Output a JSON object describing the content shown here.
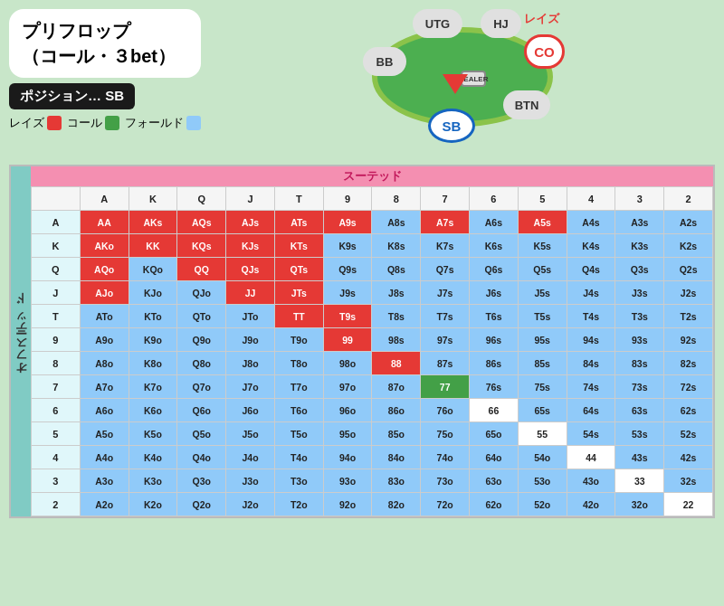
{
  "title_line1": "プリフロップ",
  "title_line2": "（コール・３bet）",
  "position_label": "ポジション… SB",
  "legend": {
    "raise": "レイズ",
    "call": "コール",
    "fold": "フォールド"
  },
  "table_label": "スーテッド",
  "offsuite_label": "オフスーテッド",
  "seats": {
    "utg": "UTG",
    "hj": "HJ",
    "co": "CO",
    "btn": "BTN",
    "sb": "SB",
    "bb": "BB",
    "dealer": "DEALER"
  },
  "raise_label": "レイズ",
  "col_headers": [
    "",
    "A",
    "K",
    "Q",
    "J",
    "T",
    "9",
    "8",
    "7",
    "6",
    "5",
    "4",
    "3",
    "2"
  ],
  "rows": [
    {
      "label": "A",
      "cells": [
        {
          "text": "AA",
          "color": "red"
        },
        {
          "text": "AKs",
          "color": "red"
        },
        {
          "text": "AQs",
          "color": "red"
        },
        {
          "text": "AJs",
          "color": "red"
        },
        {
          "text": "ATs",
          "color": "red"
        },
        {
          "text": "A9s",
          "color": "red"
        },
        {
          "text": "A8s",
          "color": "blue"
        },
        {
          "text": "A7s",
          "color": "red"
        },
        {
          "text": "A6s",
          "color": "blue"
        },
        {
          "text": "A5s",
          "color": "red"
        },
        {
          "text": "A4s",
          "color": "blue"
        },
        {
          "text": "A3s",
          "color": "blue"
        },
        {
          "text": "A2s",
          "color": "blue"
        }
      ]
    },
    {
      "label": "K",
      "cells": [
        {
          "text": "AKo",
          "color": "red"
        },
        {
          "text": "KK",
          "color": "red"
        },
        {
          "text": "KQs",
          "color": "red"
        },
        {
          "text": "KJs",
          "color": "red"
        },
        {
          "text": "KTs",
          "color": "red"
        },
        {
          "text": "K9s",
          "color": "blue"
        },
        {
          "text": "K8s",
          "color": "blue"
        },
        {
          "text": "K7s",
          "color": "blue"
        },
        {
          "text": "K6s",
          "color": "blue"
        },
        {
          "text": "K5s",
          "color": "blue"
        },
        {
          "text": "K4s",
          "color": "blue"
        },
        {
          "text": "K3s",
          "color": "blue"
        },
        {
          "text": "K2s",
          "color": "blue"
        }
      ]
    },
    {
      "label": "Q",
      "cells": [
        {
          "text": "AQo",
          "color": "red"
        },
        {
          "text": "KQo",
          "color": "blue"
        },
        {
          "text": "QQ",
          "color": "red"
        },
        {
          "text": "QJs",
          "color": "red"
        },
        {
          "text": "QTs",
          "color": "red"
        },
        {
          "text": "Q9s",
          "color": "blue"
        },
        {
          "text": "Q8s",
          "color": "blue"
        },
        {
          "text": "Q7s",
          "color": "blue"
        },
        {
          "text": "Q6s",
          "color": "blue"
        },
        {
          "text": "Q5s",
          "color": "blue"
        },
        {
          "text": "Q4s",
          "color": "blue"
        },
        {
          "text": "Q3s",
          "color": "blue"
        },
        {
          "text": "Q2s",
          "color": "blue"
        }
      ]
    },
    {
      "label": "J",
      "cells": [
        {
          "text": "AJo",
          "color": "red"
        },
        {
          "text": "KJo",
          "color": "blue"
        },
        {
          "text": "QJo",
          "color": "blue"
        },
        {
          "text": "JJ",
          "color": "red"
        },
        {
          "text": "JTs",
          "color": "red"
        },
        {
          "text": "J9s",
          "color": "blue"
        },
        {
          "text": "J8s",
          "color": "blue"
        },
        {
          "text": "J7s",
          "color": "blue"
        },
        {
          "text": "J6s",
          "color": "blue"
        },
        {
          "text": "J5s",
          "color": "blue"
        },
        {
          "text": "J4s",
          "color": "blue"
        },
        {
          "text": "J3s",
          "color": "blue"
        },
        {
          "text": "J2s",
          "color": "blue"
        }
      ]
    },
    {
      "label": "T",
      "cells": [
        {
          "text": "ATo",
          "color": "blue"
        },
        {
          "text": "KTo",
          "color": "blue"
        },
        {
          "text": "QTo",
          "color": "blue"
        },
        {
          "text": "JTo",
          "color": "blue"
        },
        {
          "text": "TT",
          "color": "red"
        },
        {
          "text": "T9s",
          "color": "red"
        },
        {
          "text": "T8s",
          "color": "blue"
        },
        {
          "text": "T7s",
          "color": "blue"
        },
        {
          "text": "T6s",
          "color": "blue"
        },
        {
          "text": "T5s",
          "color": "blue"
        },
        {
          "text": "T4s",
          "color": "blue"
        },
        {
          "text": "T3s",
          "color": "blue"
        },
        {
          "text": "T2s",
          "color": "blue"
        }
      ]
    },
    {
      "label": "9",
      "cells": [
        {
          "text": "A9o",
          "color": "blue"
        },
        {
          "text": "K9o",
          "color": "blue"
        },
        {
          "text": "Q9o",
          "color": "blue"
        },
        {
          "text": "J9o",
          "color": "blue"
        },
        {
          "text": "T9o",
          "color": "blue"
        },
        {
          "text": "99",
          "color": "red"
        },
        {
          "text": "98s",
          "color": "blue"
        },
        {
          "text": "97s",
          "color": "blue"
        },
        {
          "text": "96s",
          "color": "blue"
        },
        {
          "text": "95s",
          "color": "blue"
        },
        {
          "text": "94s",
          "color": "blue"
        },
        {
          "text": "93s",
          "color": "blue"
        },
        {
          "text": "92s",
          "color": "blue"
        }
      ]
    },
    {
      "label": "8",
      "cells": [
        {
          "text": "A8o",
          "color": "blue"
        },
        {
          "text": "K8o",
          "color": "blue"
        },
        {
          "text": "Q8o",
          "color": "blue"
        },
        {
          "text": "J8o",
          "color": "blue"
        },
        {
          "text": "T8o",
          "color": "blue"
        },
        {
          "text": "98o",
          "color": "blue"
        },
        {
          "text": "88",
          "color": "red"
        },
        {
          "text": "87s",
          "color": "blue"
        },
        {
          "text": "86s",
          "color": "blue"
        },
        {
          "text": "85s",
          "color": "blue"
        },
        {
          "text": "84s",
          "color": "blue"
        },
        {
          "text": "83s",
          "color": "blue"
        },
        {
          "text": "82s",
          "color": "blue"
        }
      ]
    },
    {
      "label": "7",
      "cells": [
        {
          "text": "A7o",
          "color": "blue"
        },
        {
          "text": "K7o",
          "color": "blue"
        },
        {
          "text": "Q7o",
          "color": "blue"
        },
        {
          "text": "J7o",
          "color": "blue"
        },
        {
          "text": "T7o",
          "color": "blue"
        },
        {
          "text": "97o",
          "color": "blue"
        },
        {
          "text": "87o",
          "color": "blue"
        },
        {
          "text": "77",
          "color": "green"
        },
        {
          "text": "76s",
          "color": "blue"
        },
        {
          "text": "75s",
          "color": "blue"
        },
        {
          "text": "74s",
          "color": "blue"
        },
        {
          "text": "73s",
          "color": "blue"
        },
        {
          "text": "72s",
          "color": "blue"
        }
      ]
    },
    {
      "label": "6",
      "cells": [
        {
          "text": "A6o",
          "color": "blue"
        },
        {
          "text": "K6o",
          "color": "blue"
        },
        {
          "text": "Q6o",
          "color": "blue"
        },
        {
          "text": "J6o",
          "color": "blue"
        },
        {
          "text": "T6o",
          "color": "blue"
        },
        {
          "text": "96o",
          "color": "blue"
        },
        {
          "text": "86o",
          "color": "blue"
        },
        {
          "text": "76o",
          "color": "blue"
        },
        {
          "text": "66",
          "color": "white"
        },
        {
          "text": "65s",
          "color": "blue"
        },
        {
          "text": "64s",
          "color": "blue"
        },
        {
          "text": "63s",
          "color": "blue"
        },
        {
          "text": "62s",
          "color": "blue"
        }
      ]
    },
    {
      "label": "5",
      "cells": [
        {
          "text": "A5o",
          "color": "blue"
        },
        {
          "text": "K5o",
          "color": "blue"
        },
        {
          "text": "Q5o",
          "color": "blue"
        },
        {
          "text": "J5o",
          "color": "blue"
        },
        {
          "text": "T5o",
          "color": "blue"
        },
        {
          "text": "95o",
          "color": "blue"
        },
        {
          "text": "85o",
          "color": "blue"
        },
        {
          "text": "75o",
          "color": "blue"
        },
        {
          "text": "65o",
          "color": "blue"
        },
        {
          "text": "55",
          "color": "white"
        },
        {
          "text": "54s",
          "color": "blue"
        },
        {
          "text": "53s",
          "color": "blue"
        },
        {
          "text": "52s",
          "color": "blue"
        }
      ]
    },
    {
      "label": "4",
      "cells": [
        {
          "text": "A4o",
          "color": "blue"
        },
        {
          "text": "K4o",
          "color": "blue"
        },
        {
          "text": "Q4o",
          "color": "blue"
        },
        {
          "text": "J4o",
          "color": "blue"
        },
        {
          "text": "T4o",
          "color": "blue"
        },
        {
          "text": "94o",
          "color": "blue"
        },
        {
          "text": "84o",
          "color": "blue"
        },
        {
          "text": "74o",
          "color": "blue"
        },
        {
          "text": "64o",
          "color": "blue"
        },
        {
          "text": "54o",
          "color": "blue"
        },
        {
          "text": "44",
          "color": "white"
        },
        {
          "text": "43s",
          "color": "blue"
        },
        {
          "text": "42s",
          "color": "blue"
        }
      ]
    },
    {
      "label": "3",
      "cells": [
        {
          "text": "A3o",
          "color": "blue"
        },
        {
          "text": "K3o",
          "color": "blue"
        },
        {
          "text": "Q3o",
          "color": "blue"
        },
        {
          "text": "J3o",
          "color": "blue"
        },
        {
          "text": "T3o",
          "color": "blue"
        },
        {
          "text": "93o",
          "color": "blue"
        },
        {
          "text": "83o",
          "color": "blue"
        },
        {
          "text": "73o",
          "color": "blue"
        },
        {
          "text": "63o",
          "color": "blue"
        },
        {
          "text": "53o",
          "color": "blue"
        },
        {
          "text": "43o",
          "color": "blue"
        },
        {
          "text": "33",
          "color": "white"
        },
        {
          "text": "32s",
          "color": "blue"
        }
      ]
    },
    {
      "label": "2",
      "cells": [
        {
          "text": "A2o",
          "color": "blue"
        },
        {
          "text": "K2o",
          "color": "blue"
        },
        {
          "text": "Q2o",
          "color": "blue"
        },
        {
          "text": "J2o",
          "color": "blue"
        },
        {
          "text": "T2o",
          "color": "blue"
        },
        {
          "text": "92o",
          "color": "blue"
        },
        {
          "text": "82o",
          "color": "blue"
        },
        {
          "text": "72o",
          "color": "blue"
        },
        {
          "text": "62o",
          "color": "blue"
        },
        {
          "text": "52o",
          "color": "blue"
        },
        {
          "text": "42o",
          "color": "blue"
        },
        {
          "text": "32o",
          "color": "blue"
        },
        {
          "text": "22",
          "color": "white"
        }
      ]
    }
  ]
}
